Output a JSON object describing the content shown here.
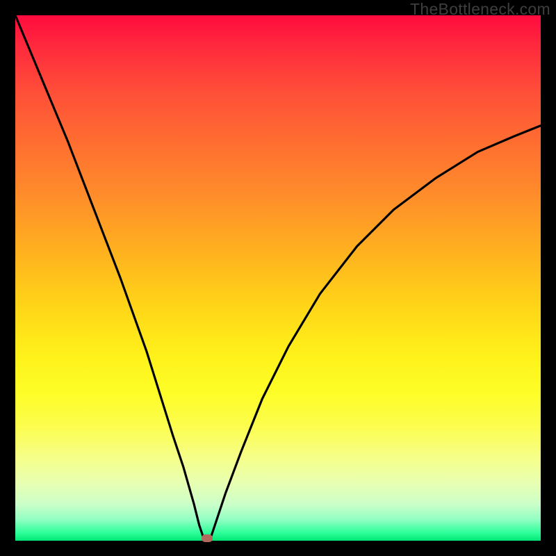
{
  "watermark": "TheBottleneck.com",
  "chart_data": {
    "type": "line",
    "title": "",
    "xlabel": "",
    "ylabel": "",
    "xlim": [
      0,
      100
    ],
    "ylim": [
      0,
      100
    ],
    "series": [
      {
        "name": "curve",
        "x": [
          0,
          5,
          10,
          15,
          20,
          25,
          30,
          32,
          34,
          35,
          35.8,
          36.4,
          37,
          38,
          40,
          43,
          47,
          52,
          58,
          65,
          72,
          80,
          88,
          95,
          100
        ],
        "y": [
          100,
          88,
          76,
          63,
          50,
          36,
          20,
          14,
          7,
          3,
          0.6,
          0,
          0,
          3,
          9,
          17,
          27,
          37,
          47,
          56,
          63,
          69,
          74,
          77,
          79
        ]
      }
    ],
    "marker": {
      "x": 36.5,
      "y": 0.5
    },
    "colors": {
      "curve": "#000000",
      "marker": "#b36a5e",
      "gradient_top": "#ff0b3e",
      "gradient_bottom": "#00e676"
    }
  }
}
